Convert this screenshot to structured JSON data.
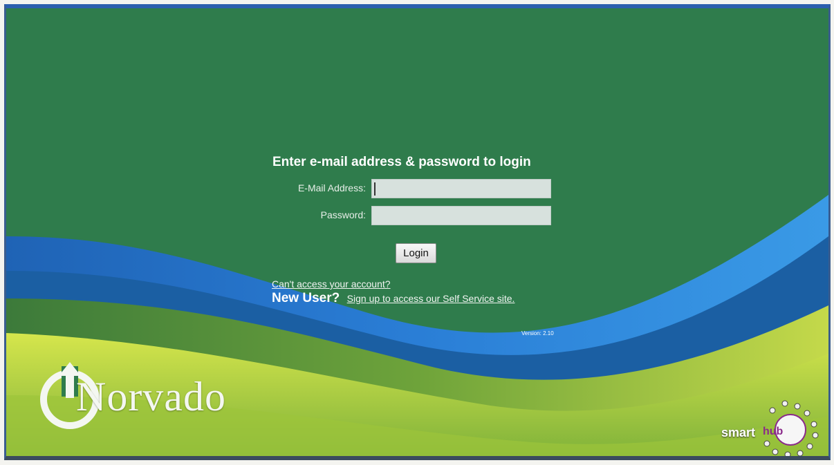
{
  "login": {
    "heading": "Enter e-mail address & password to login",
    "email_label": "E-Mail Address:",
    "email_value": "",
    "password_label": "Password:",
    "password_value": "",
    "login_button": "Login"
  },
  "links": {
    "cant_access": "Can't access your account?",
    "new_user_label": "New User?",
    "signup": "Sign up to access our Self Service site."
  },
  "footer": {
    "version": "Version: 2.10"
  },
  "brand": {
    "company": "Norvado",
    "product": "smarthub",
    "colors": {
      "background": "#2f7c4c",
      "wave_blue": "#2a7ed6",
      "wave_lime": "#c6dc3a",
      "border": "#2c5fae"
    }
  },
  "icons": {
    "power_logo": "power-arrow-icon",
    "smarthub_logo": "smarthub-dots-icon"
  }
}
